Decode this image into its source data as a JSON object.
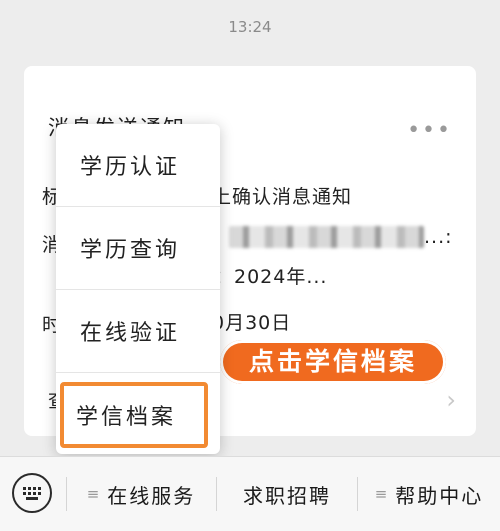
{
  "status_time": "13:24",
  "card": {
    "title": "消息发送通知",
    "row1_label": "标",
    "row1_text": "上确认消息通知",
    "row2_label": "消",
    "row2_tail": "...:",
    "row3_text": "：2024年...",
    "row4_label": "时",
    "row4_text": "0月30日",
    "detail_label": "查"
  },
  "badge": "点击学信档案",
  "menu": {
    "items": [
      "学历认证",
      "学历查询",
      "在线验证",
      "学信档案"
    ],
    "highlight_color": "#f28a32"
  },
  "bottom_tabs": [
    "在线服务",
    "求职招聘",
    "帮助中心"
  ],
  "colors": {
    "badge_bg": "#f06a1f",
    "background": "#ededed"
  }
}
